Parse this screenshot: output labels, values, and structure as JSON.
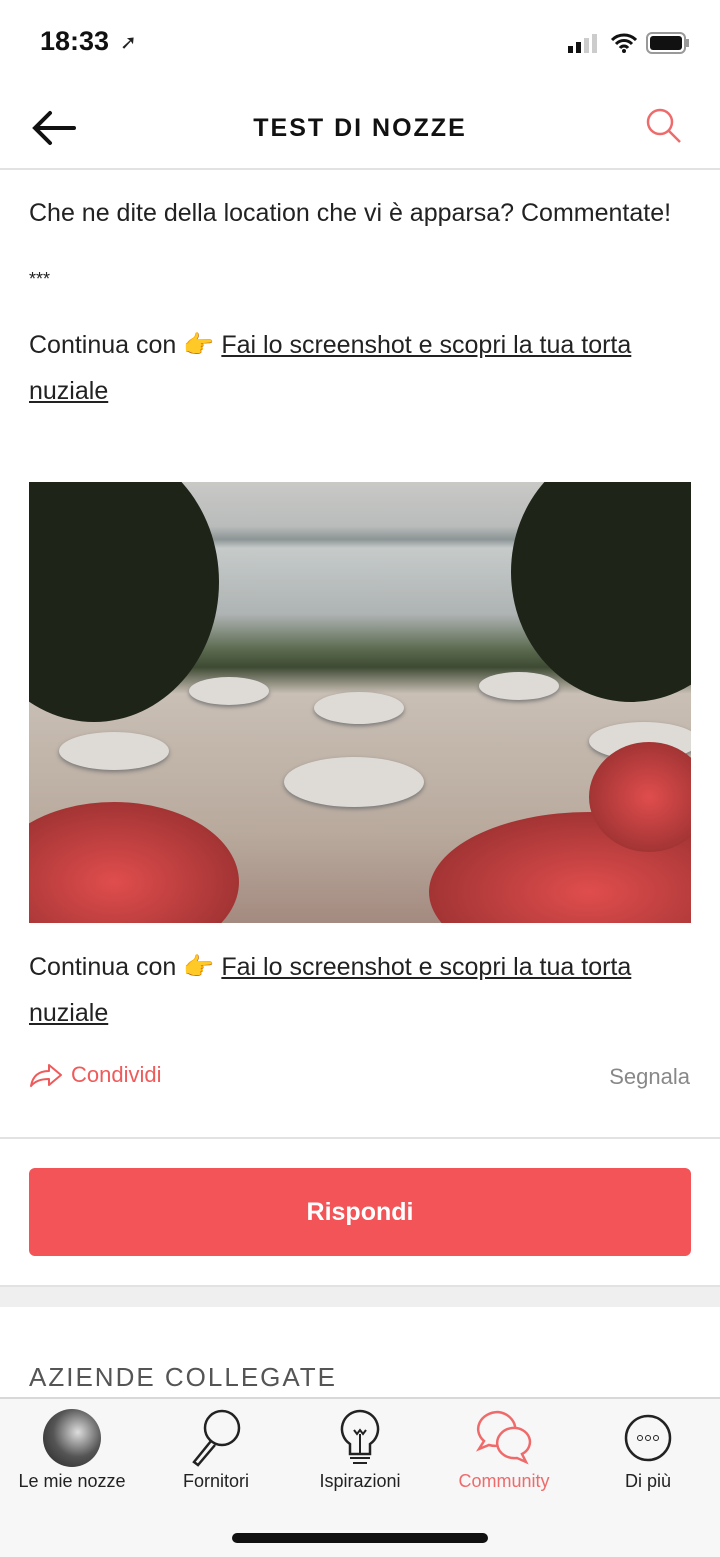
{
  "status": {
    "time": "18:33"
  },
  "header": {
    "title": "TEST DI NOZZE",
    "back_icon": "arrow-left-icon",
    "search_icon": "search-icon"
  },
  "post": {
    "question": "Che ne dite della location che vi è apparsa? Commentate!",
    "separator": "***",
    "continue_prefix": "Continua con 👉 ",
    "continue_link": "Fai lo screenshot e scopri la tua torta nuziale",
    "share_label": "Condividi",
    "report_label": "Segnala"
  },
  "reply_label": "Rispondi",
  "section_title": "AZIENDE COLLEGATE",
  "tabs": [
    {
      "label": "Le mie nozze"
    },
    {
      "label": "Fornitori"
    },
    {
      "label": "Ispirazioni"
    },
    {
      "label": "Community",
      "active": true
    },
    {
      "label": "Di più"
    }
  ],
  "colors": {
    "accent": "#f25458",
    "active_tab": "#ef6b6b"
  }
}
